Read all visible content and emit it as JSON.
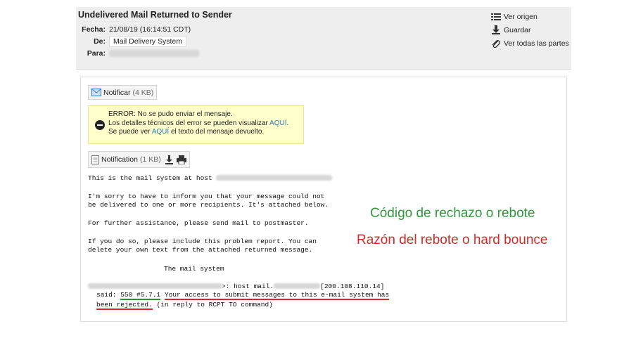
{
  "header": {
    "subject": "Undelivered Mail Returned to Sender",
    "fecha_label": "Fecha:",
    "fecha_value": "21/08/19 (16:14:51 CDT)",
    "de_label": "De:",
    "de_value": "Mail Delivery System",
    "para_label": "Para:"
  },
  "actions": {
    "ver_origen": "Ver origen",
    "guardar": "Guardar",
    "ver_partes": "Ver todas las partes"
  },
  "attachments": {
    "notificar_name": "Notificar",
    "notificar_size": "(4 KB)",
    "notification_name": "Notification",
    "notification_size": "(1 KB)"
  },
  "error_box": {
    "line1": "ERROR: No se pudo enviar el mensaje.",
    "line2_pre": "Los detalles técnicos del error se pueden visualizar ",
    "line2_link": "AQUÍ",
    "line2_post": ".",
    "line3_pre": "Se puede ver ",
    "line3_link": "AQUÍ",
    "line3_post": " el texto del mensaje devuelto."
  },
  "message": {
    "l1": "This is the mail system at host",
    "l2": "I'm sorry to have to inform you that your message could not",
    "l3": "be delivered to one or more recipients. It's attached below.",
    "l4": "For further assistance, please send mail to postmaster.",
    "l5": "If you do so, please include this problem report. You can",
    "l6": "delete your own text from the attached returned message.",
    "l7": "The mail system",
    "l8_mid": ">: host mail.",
    "l8_ip": "[200.108.110.14]",
    "l9_said": "said: ",
    "l9_code": "550 #5.7.1",
    "l9_reason": "Your access to submit messages to this e-mail system has",
    "l10_reason": "been rejected.",
    "l10_rest": " (in reply to RCPT TO command)"
  },
  "annotations": {
    "green": "Código de rechazo o rebote",
    "red": "Razón del rebote o hard bounce"
  },
  "colors": {
    "annotation_green": "#2f9a3a",
    "annotation_red": "#d22b2b",
    "link": "#2a78b8",
    "error_bg": "#ffffcc"
  },
  "icons": [
    "list-icon",
    "download-icon",
    "paperclip-icon",
    "envelope-icon",
    "document-icon",
    "printer-icon",
    "error-icon"
  ]
}
